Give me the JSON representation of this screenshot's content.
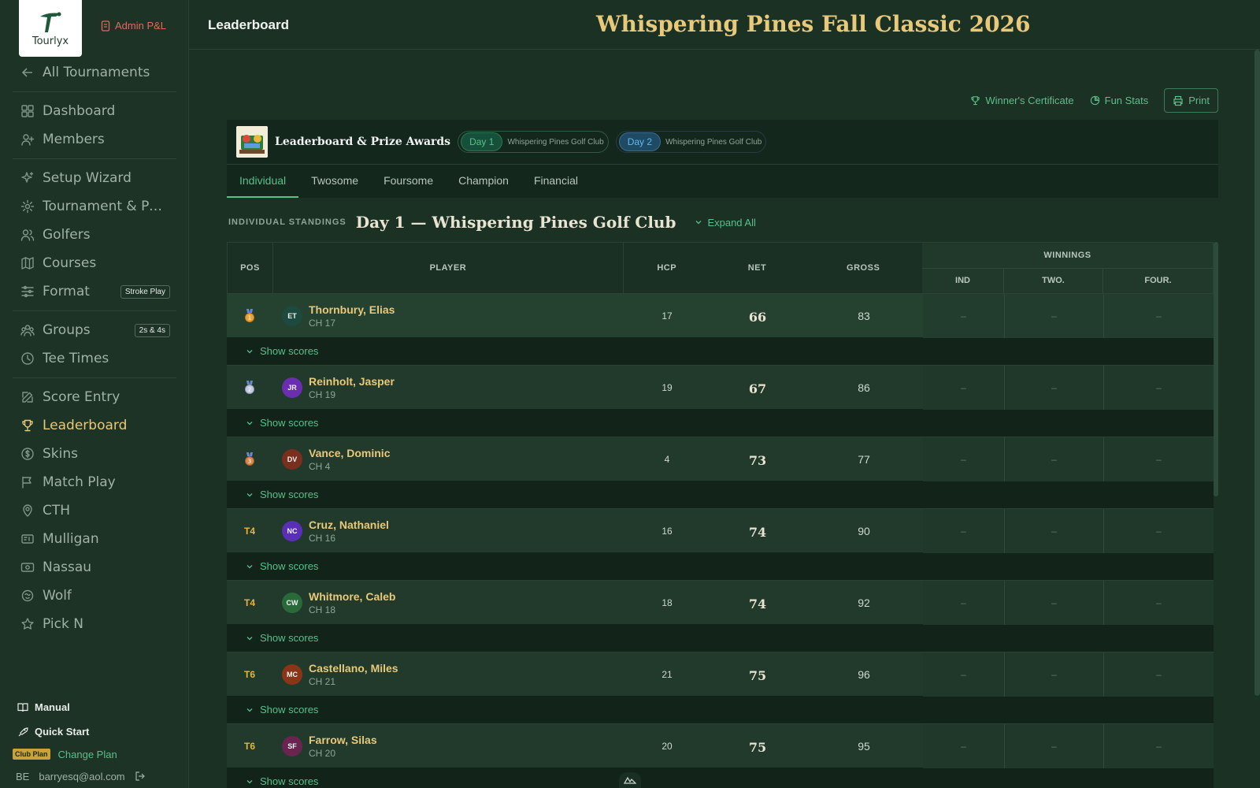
{
  "brand": {
    "name": "Tourlyx",
    "admin_link": "Admin P&L"
  },
  "sidebar": {
    "back": "All Tournaments",
    "group1": [
      {
        "label": "Dashboard",
        "icon": "dashboard-icon"
      },
      {
        "label": "Members",
        "icon": "user-plus-icon"
      }
    ],
    "group2": [
      {
        "label": "Setup Wizard",
        "icon": "sparkle-icon"
      },
      {
        "label": "Tournament & Priz...",
        "icon": "gear-icon"
      },
      {
        "label": "Golfers",
        "icon": "users-icon"
      },
      {
        "label": "Courses",
        "icon": "map-icon"
      },
      {
        "label": "Format",
        "icon": "sliders-icon",
        "badge": "Stroke Play"
      }
    ],
    "group3": [
      {
        "label": "Groups",
        "icon": "group-icon",
        "badge": "2s & 4s"
      },
      {
        "label": "Tee Times",
        "icon": "clock-icon"
      }
    ],
    "group4": [
      {
        "label": "Score Entry",
        "icon": "edit-icon"
      },
      {
        "label": "Leaderboard",
        "icon": "trophy-icon",
        "active": true
      },
      {
        "label": "Skins",
        "icon": "dollar-icon"
      },
      {
        "label": "Match Play",
        "icon": "flag-icon"
      },
      {
        "label": "CTH",
        "icon": "pin-icon"
      },
      {
        "label": "Mulligan",
        "icon": "ticket-icon"
      },
      {
        "label": "Nassau",
        "icon": "banknote-icon"
      },
      {
        "label": "Wolf",
        "icon": "wolf-icon"
      },
      {
        "label": "Pick N",
        "icon": "star-icon"
      }
    ],
    "manual": "Manual",
    "quick_start": "Quick Start",
    "plan_badge": "Club Plan",
    "change_plan": "Change Plan",
    "user_initials": "BE",
    "user_email": "barryesq@aol.com"
  },
  "header": {
    "page_title": "Leaderboard",
    "event_title": "Whispering Pines Fall Classic 2026"
  },
  "actions": {
    "certificate": "Winner's Certificate",
    "fun_stats": "Fun Stats",
    "print": "Print"
  },
  "panel": {
    "title": "Leaderboard & Prize Awards",
    "days": [
      {
        "chip": "Day 1",
        "course": "Whispering Pines Golf Club"
      },
      {
        "chip": "Day 2",
        "course": "Whispering Pines Golf Club"
      }
    ],
    "tabs": [
      "Individual",
      "Twosome",
      "Foursome",
      "Champion",
      "Financial"
    ]
  },
  "standings": {
    "label": "INDIVIDUAL STANDINGS",
    "title": "Day 1 — Whispering Pines Golf Club",
    "expand": "Expand All",
    "show_scores": "Show scores",
    "columns": {
      "pos": "POS",
      "player": "PLAYER",
      "hcp": "HCP",
      "net": "NET",
      "gross": "GROSS",
      "winnings": "WINNINGS",
      "ind": "IND",
      "two": "TWO.",
      "four": "FOUR."
    },
    "rows": [
      {
        "pos": "1",
        "medal": "gold",
        "initials": "ET",
        "avatar_color": "#1d4a3e",
        "name": "Thornbury, Elias",
        "ch": "CH 17",
        "hcp": "17",
        "net": "66",
        "gross": "83",
        "ind": "–",
        "two": "–",
        "four": "–"
      },
      {
        "pos": "2",
        "medal": "silver",
        "initials": "JR",
        "avatar_color": "#6a2fb0",
        "name": "Reinholt, Jasper",
        "ch": "CH 19",
        "hcp": "19",
        "net": "67",
        "gross": "86",
        "ind": "–",
        "two": "–",
        "four": "–"
      },
      {
        "pos": "3",
        "medal": "bronze",
        "initials": "DV",
        "avatar_color": "#7a2e1e",
        "name": "Vance, Dominic",
        "ch": "CH 4",
        "hcp": "4",
        "net": "73",
        "gross": "77",
        "ind": "–",
        "two": "–",
        "four": "–"
      },
      {
        "pos": "T4",
        "initials": "NC",
        "avatar_color": "#5a2fb8",
        "name": "Cruz, Nathaniel",
        "ch": "CH 16",
        "hcp": "16",
        "net": "74",
        "gross": "90",
        "ind": "–",
        "two": "–",
        "four": "–"
      },
      {
        "pos": "T4",
        "initials": "CW",
        "avatar_color": "#2a6a3a",
        "name": "Whitmore, Caleb",
        "ch": "CH 18",
        "hcp": "18",
        "net": "74",
        "gross": "92",
        "ind": "–",
        "two": "–",
        "four": "–"
      },
      {
        "pos": "T6",
        "initials": "MC",
        "avatar_color": "#8a3418",
        "name": "Castellano, Miles",
        "ch": "CH 21",
        "hcp": "21",
        "net": "75",
        "gross": "96",
        "ind": "–",
        "two": "–",
        "four": "–"
      },
      {
        "pos": "T6",
        "initials": "SF",
        "avatar_color": "#6a2450",
        "name": "Farrow, Silas",
        "ch": "CH 20",
        "hcp": "20",
        "net": "75",
        "gross": "95",
        "ind": "–",
        "two": "–",
        "four": "–"
      }
    ]
  }
}
